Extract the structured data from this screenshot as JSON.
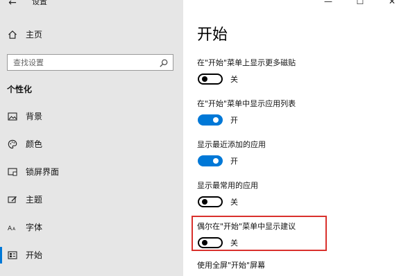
{
  "window": {
    "back_glyph": "←",
    "title": "设置",
    "minimize_glyph": "—",
    "maximize_glyph": "☐",
    "close_glyph": "✕"
  },
  "sidebar": {
    "home_label": "主页",
    "search_placeholder": "查找设置",
    "section_title": "个性化",
    "items": [
      {
        "label": "背景",
        "icon": "picture-icon"
      },
      {
        "label": "颜色",
        "icon": "palette-icon"
      },
      {
        "label": "锁屏界面",
        "icon": "lock-screen-icon"
      },
      {
        "label": "主题",
        "icon": "theme-icon"
      },
      {
        "label": "字体",
        "icon": "font-icon"
      },
      {
        "label": "开始",
        "icon": "start-icon"
      }
    ]
  },
  "main": {
    "title": "开始",
    "settings": [
      {
        "label": "在\"开始\"菜单上显示更多磁贴",
        "state": "关",
        "on": false
      },
      {
        "label": "在\"开始\"菜单中显示应用列表",
        "state": "开",
        "on": true
      },
      {
        "label": "显示最近添加的应用",
        "state": "开",
        "on": true
      },
      {
        "label": "显示最常用的应用",
        "state": "关",
        "on": false
      },
      {
        "label": "偶尔在\"开始\"菜单中显示建议",
        "state": "关",
        "on": false
      },
      {
        "label": "使用全屏\"开始\"屏幕"
      }
    ]
  },
  "colors": {
    "accent": "#0078d7",
    "sidebar_bg": "#e6e6e6",
    "highlight_border": "#d9302c"
  }
}
